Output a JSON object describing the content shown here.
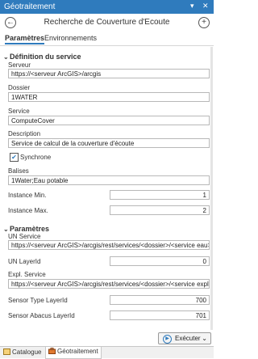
{
  "window": {
    "title": "Géotraitement",
    "pin": "▾",
    "close": "✕"
  },
  "header": {
    "back": "←",
    "title": "Recherche de Couverture d'Ecoute",
    "add": "+"
  },
  "tabs": [
    {
      "label": "Paramètres"
    },
    {
      "label": "Environnements"
    }
  ],
  "sections": {
    "service": {
      "title": "Définition du service",
      "fields": {
        "serveur": {
          "label": "Serveur",
          "value": "https://<serveur ArcGIS>/arcgis"
        },
        "dossier": {
          "label": "Dossier",
          "value": "1WATER"
        },
        "service": {
          "label": "Service",
          "value": "ComputeCover"
        },
        "description": {
          "label": "Description",
          "value": "Service de calcul de la couverture d'écoute"
        },
        "synchrone": {
          "label": "Synchrone",
          "checked": true
        },
        "balises": {
          "label": "Balises",
          "value": "1Water;Eau potable"
        },
        "instance_min": {
          "label": "Instance Min.",
          "value": "1"
        },
        "instance_max": {
          "label": "Instance Max.",
          "value": "2"
        }
      }
    },
    "parametres": {
      "title": "Paramètres",
      "fields": {
        "un_service": {
          "label": "UN Service",
          "value": "https://<serveur ArcGIS>/arcgis/rest/services/<dossier>/<service eau>/Fe"
        },
        "un_layerid": {
          "label": "UN LayerId",
          "value": "0"
        },
        "expl_service": {
          "label": "Expl. Service",
          "value": "https://<serveur ArcGIS>/arcgis/rest/services/<dossier>/<service exploitat"
        },
        "sensor_type": {
          "label": "Sensor Type LayerId",
          "value": "700"
        },
        "sensor_abacus": {
          "label": "Sensor Abacus LayerId",
          "value": "701"
        }
      }
    }
  },
  "run": {
    "label": "Exécuter",
    "caret": "⌄"
  },
  "bottom_tabs": [
    {
      "label": "Catalogue"
    },
    {
      "label": "Géotraitement"
    }
  ]
}
